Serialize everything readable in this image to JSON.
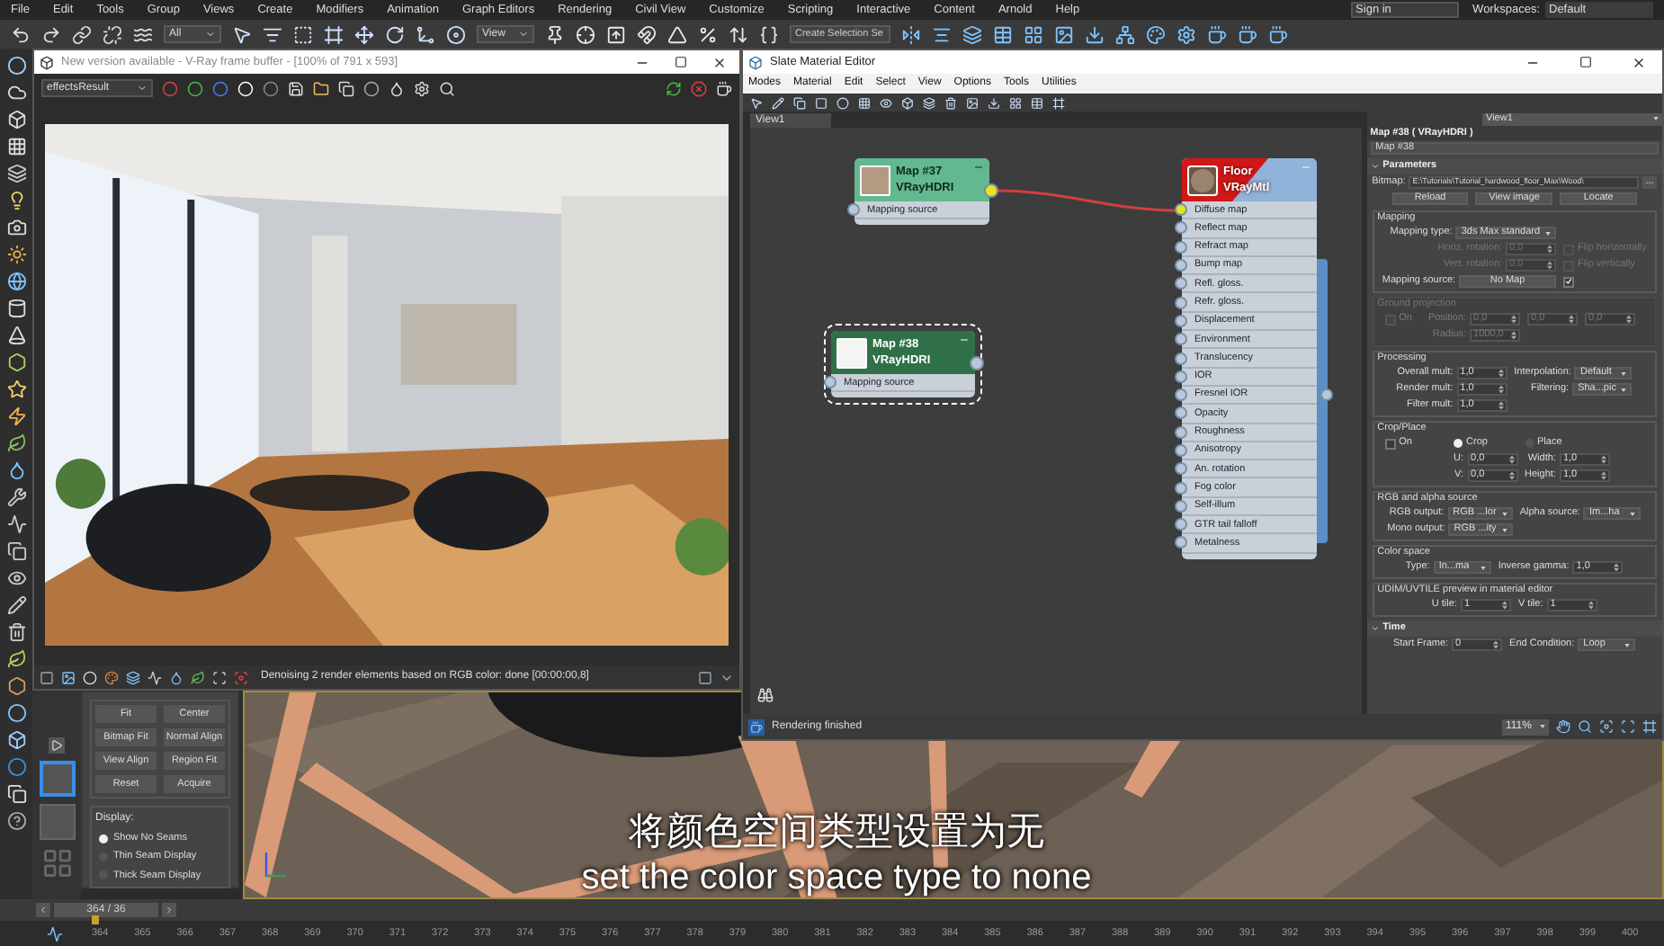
{
  "menu_bar": {
    "items": [
      "File",
      "Edit",
      "Tools",
      "Group",
      "Views",
      "Create",
      "Modifiers",
      "Animation",
      "Graph Editors",
      "Rendering",
      "Civil View",
      "Customize",
      "Scripting",
      "Interactive",
      "Content",
      "Arnold",
      "Help"
    ],
    "sign_in": "Sign in",
    "workspaces_label": "Workspaces:",
    "workspace": "Default"
  },
  "main_toolbar": {
    "selection_filter": "All",
    "reference_coord": "View",
    "selection_set": "Create Selection Se"
  },
  "frame_buffer": {
    "title": "New version available - V-Ray frame buffer - [100% of 791 x 593]",
    "channel": "effectsResult",
    "status": "Denoising 2 render elements based on RGB color: done [00:00:00,8]"
  },
  "slate_editor": {
    "title": "Slate Material Editor",
    "menus": [
      "Modes",
      "Material",
      "Edit",
      "Select",
      "View",
      "Options",
      "Tools",
      "Utilities"
    ],
    "view_tab": "View1",
    "nodes": [
      {
        "kind": "map",
        "title": "Map #37",
        "subtitle": "VRayHDRI",
        "selected": false,
        "output_connected": true,
        "slots": [
          {
            "label": "Mapping source",
            "connected": false
          }
        ]
      },
      {
        "kind": "map",
        "title": "Map #38",
        "subtitle": "VRayHDRI",
        "selected": true,
        "output_connected": false,
        "slots": [
          {
            "label": "Mapping source",
            "connected": false
          }
        ]
      },
      {
        "kind": "material",
        "title": "Floor",
        "subtitle": "VRayMtl",
        "selected": false,
        "output_connected": false,
        "slots": [
          {
            "label": "Diffuse map",
            "connected": true
          },
          {
            "label": "Reflect map",
            "connected": false
          },
          {
            "label": "Refract map",
            "connected": false
          },
          {
            "label": "Bump map",
            "connected": false
          },
          {
            "label": "Refl. gloss.",
            "connected": false
          },
          {
            "label": "Refr. gloss.",
            "connected": false
          },
          {
            "label": "Displacement",
            "connected": false
          },
          {
            "label": "Environment",
            "connected": false
          },
          {
            "label": "Translucency",
            "connected": false
          },
          {
            "label": "IOR",
            "connected": false
          },
          {
            "label": "Fresnel IOR",
            "connected": false
          },
          {
            "label": "Opacity",
            "connected": false
          },
          {
            "label": "Roughness",
            "connected": false
          },
          {
            "label": "Anisotropy",
            "connected": false
          },
          {
            "label": "An. rotation",
            "connected": false
          },
          {
            "label": "Fog color",
            "connected": false
          },
          {
            "label": "Self-illum",
            "connected": false
          },
          {
            "label": "GTR tail falloff",
            "connected": false
          },
          {
            "label": "Metalness",
            "connected": false
          }
        ]
      }
    ],
    "status": "Rendering finished",
    "zoom": "111%"
  },
  "material_panel": {
    "view_selector": "View1",
    "title": "Map #38 ( VRayHDRI )",
    "name": "Map #38",
    "rollouts": [
      {
        "title": "Parameters",
        "expanded": true,
        "bitmap": {
          "label": "Bitmap:",
          "path": "E:\\Tutorials\\Tutorial_hardwood_floor_Max\\Wood\\",
          "browse": "..."
        },
        "file_buttons": [
          "Reload",
          "View image",
          "Locate"
        ],
        "groups": [
          {
            "title": "Mapping",
            "disabled": false,
            "rows": [
              {
                "disabled": false,
                "items": [
                  {
                    "kind": "dropdown",
                    "label": "Mapping type:",
                    "value": "3ds Max standard"
                  }
                ]
              },
              {
                "disabled": true,
                "items": [
                  {
                    "kind": "spinner",
                    "label": "Horiz. rotation:",
                    "value": "0,0"
                  },
                  {
                    "kind": "checkbox",
                    "label": "Flip horizontally",
                    "checked": false
                  }
                ]
              },
              {
                "disabled": true,
                "items": [
                  {
                    "kind": "spinner",
                    "label": "Vert. rotation:",
                    "value": "0,0"
                  },
                  {
                    "kind": "checkbox",
                    "label": "Flip vertically",
                    "checked": false
                  }
                ]
              },
              {
                "disabled": false,
                "items": [
                  {
                    "kind": "button",
                    "label": "Mapping source:",
                    "value": "No Map"
                  },
                  {
                    "kind": "checkbox",
                    "checked": true
                  }
                ]
              }
            ]
          },
          {
            "title": "Ground projection",
            "disabled": true,
            "toggle": {
              "label": "On",
              "checked": false
            },
            "rows": [
              {
                "items": [
                  {
                    "kind": "spinner",
                    "label": "Position:",
                    "value": "0,0"
                  },
                  {
                    "kind": "spinner",
                    "value": "0,0"
                  },
                  {
                    "kind": "spinner",
                    "value": "0,0"
                  }
                ]
              },
              {
                "items": [
                  {
                    "kind": "spinner",
                    "label": "Radius:",
                    "value": "1000,0"
                  }
                ]
              }
            ]
          },
          {
            "title": "Processing",
            "disabled": false,
            "rows": [
              {
                "disabled": false,
                "items": [
                  {
                    "kind": "spinner",
                    "label": "Overall mult:",
                    "value": "1,0"
                  },
                  {
                    "kind": "dropdown",
                    "label": "Interpolation:",
                    "value": "Default"
                  }
                ]
              },
              {
                "disabled": false,
                "items": [
                  {
                    "kind": "spinner",
                    "label": "Render mult:",
                    "value": "1,0"
                  },
                  {
                    "kind": "dropdown",
                    "label": "Filtering:",
                    "value": "Sha...pic"
                  }
                ]
              },
              {
                "disabled": false,
                "items": [
                  {
                    "kind": "spinner",
                    "label": "Filter mult:",
                    "value": "1,0"
                  }
                ]
              }
            ]
          },
          {
            "title": "Crop/Place",
            "disabled": false,
            "toggle": {
              "label": "On",
              "checked": false
            },
            "rows": [
              {
                "disabled": false,
                "items": [
                  {
                    "kind": "radio",
                    "label": "Crop",
                    "selected": true
                  },
                  {
                    "kind": "radio",
                    "label": "Place",
                    "selected": false
                  }
                ]
              },
              {
                "disabled": false,
                "items": [
                  {
                    "kind": "spinner",
                    "label": "U:",
                    "value": "0,0"
                  },
                  {
                    "kind": "spinner",
                    "label": "Width:",
                    "value": "1,0"
                  }
                ]
              },
              {
                "disabled": false,
                "items": [
                  {
                    "kind": "spinner",
                    "label": "V:",
                    "value": "0,0"
                  },
                  {
                    "kind": "spinner",
                    "label": "Height:",
                    "value": "1,0"
                  }
                ]
              }
            ]
          },
          {
            "title": "RGB and alpha source",
            "disabled": false,
            "rows": [
              {
                "disabled": false,
                "items": [
                  {
                    "kind": "dropdown",
                    "label": "RGB output:",
                    "value": "RGB ...lor"
                  },
                  {
                    "kind": "dropdown",
                    "label": "Alpha source:",
                    "value": "Im...ha"
                  }
                ]
              },
              {
                "disabled": false,
                "items": [
                  {
                    "kind": "dropdown",
                    "label": "Mono output:",
                    "value": "RGB ...ity"
                  }
                ]
              }
            ]
          },
          {
            "title": "Color space",
            "disabled": false,
            "rows": [
              {
                "disabled": false,
                "items": [
                  {
                    "kind": "dropdown",
                    "label": "Type:",
                    "value": "In...ma"
                  },
                  {
                    "kind": "spinner",
                    "label": "Inverse gamma:",
                    "value": "1,0"
                  }
                ]
              }
            ]
          },
          {
            "title": "UDIM/UVTILE preview in material editor",
            "disabled": false,
            "rows": [
              {
                "disabled": false,
                "items": [
                  {
                    "kind": "spinner",
                    "label": "U tile:",
                    "value": "1"
                  },
                  {
                    "kind": "spinner",
                    "label": "V tile:",
                    "value": "1"
                  }
                ]
              }
            ]
          }
        ]
      },
      {
        "title": "Time",
        "expanded": true,
        "groups": [
          {
            "rows": [
              {
                "disabled": false,
                "items": [
                  {
                    "kind": "spinner",
                    "label": "Start Frame:",
                    "value": "0"
                  },
                  {
                    "kind": "dropdown",
                    "label": "End Condition:",
                    "value": "Loop"
                  }
                ]
              }
            ]
          }
        ]
      }
    ]
  },
  "uvw_panel": {
    "buttons": [
      "Fit",
      "Center",
      "Bitmap Fit",
      "Normal Align",
      "View Align",
      "Region Fit",
      "Reset",
      "Acquire"
    ],
    "display_label": "Display:",
    "display_options": [
      {
        "label": "Show No Seams",
        "selected": true
      },
      {
        "label": "Thin Seam Display",
        "selected": false
      },
      {
        "label": "Thick Seam Display",
        "selected": false
      }
    ]
  },
  "viewport": {
    "subtitle_zh": "将颜色空间类型设置为无",
    "subtitle_en": "set the color space type to none"
  },
  "timeline": {
    "frame": "364 / 36",
    "ticks": [
      "364",
      "365",
      "366",
      "367",
      "368",
      "369",
      "370",
      "371",
      "372",
      "373",
      "374",
      "375",
      "376",
      "377",
      "378",
      "379",
      "380",
      "381",
      "382",
      "383",
      "384",
      "385",
      "386",
      "387",
      "388",
      "389",
      "390",
      "391",
      "392",
      "393",
      "394",
      "395",
      "396",
      "397",
      "398",
      "399",
      "400"
    ]
  }
}
